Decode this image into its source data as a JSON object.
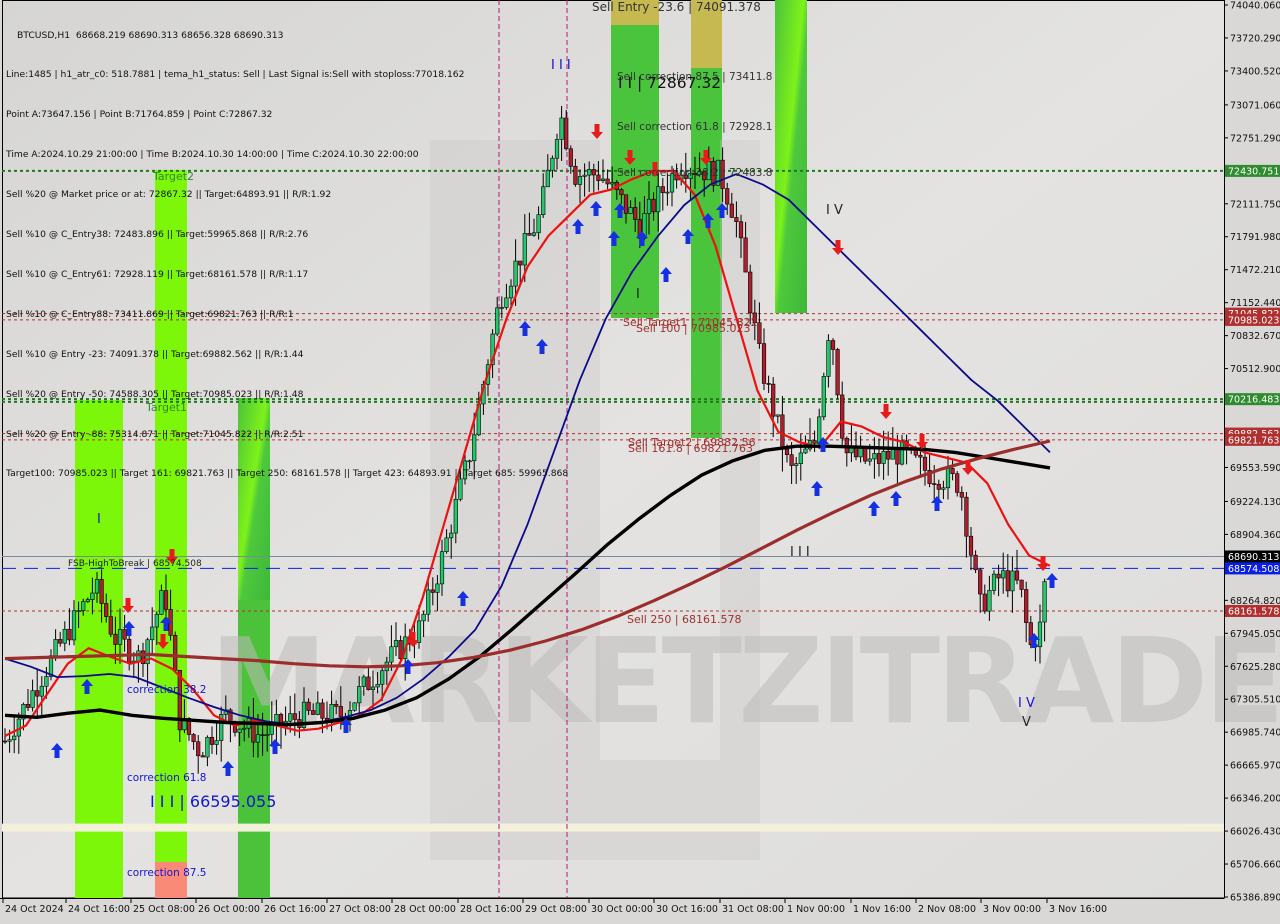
{
  "chart_data": {
    "type": "candlestick",
    "symbol": "BTCUSD",
    "timeframe": "H1",
    "ohlc_header": "BTCUSD,H1  68668.219 68690.313 68656.328 68690.313",
    "info_lines": [
      "Line:1485 | h1_atr_c0: 518.7881 | tema_h1_status: Sell | Last Signal is:Sell with stoploss:77018.162",
      "Point A:73647.156 | Point B:71764.859 | Point C:72867.32",
      "Time A:2024.10.29 21:00:00 | Time B:2024.10.30 14:00:00 | Time C:2024.10.30 22:00:00",
      "Sell %20 @ Market price or at: 72867.32 || Target:64893.91 || R/R:1.92",
      "Sell %10 @ C_Entry38: 72483.896 || Target:59965.868 || R/R:2.76",
      "Sell %10 @ C_Entry61: 72928.119 || Target:68161.578 || R/R:1.17",
      "Sell %10 @ C_Entry88: 73411.869 || Target:69821.763 || R/R:1",
      "Sell %10 @ Entry -23: 74091.378 || Target:69882.562 || R/R:1.44",
      "Sell %20 @ Entry -50: 74588.305 || Target:70985.023 || R/R:1.48",
      "Sell %20 @ Entry -88: 75314.871 || Target:71045.822 || R/R:2.51",
      "Target100: 70985.023 || Target 161: 69821.763 || Target 250: 68161.578 || Target 423: 64893.91 || Target 685: 59965.868"
    ],
    "ylim": [
      65386.89,
      74040.06
    ],
    "y_ticks": [
      "74040.060",
      "73720.290",
      "73400.520",
      "73071.060",
      "72751.290",
      "72430.751",
      "72111.750",
      "71791.980",
      "71472.210",
      "71152.440",
      "70832.670",
      "70512.900",
      "70216.483",
      "69553.590",
      "69224.130",
      "68904.360",
      "68690.313",
      "68574.508",
      "68264.820",
      "67945.050",
      "67625.280",
      "67305.510",
      "66985.740",
      "66665.970",
      "66346.200",
      "66026.430",
      "65706.660",
      "65386.890"
    ],
    "x_ticks": [
      "24 Oct 2024",
      "24 Oct 16:00",
      "25 Oct 08:00",
      "26 Oct 00:00",
      "26 Oct 16:00",
      "27 Oct 08:00",
      "28 Oct 00:00",
      "28 Oct 16:00",
      "29 Oct 08:00",
      "30 Oct 00:00",
      "30 Oct 16:00",
      "31 Oct 08:00",
      "1 Nov 00:00",
      "1 Nov 16:00",
      "2 Nov 08:00",
      "3 Nov 00:00",
      "3 Nov 16:00"
    ],
    "price_labels": [
      {
        "value": 72430.751,
        "text": "72430.751",
        "color": "#2e8b2e"
      },
      {
        "value": 71045.822,
        "text": "71045.822",
        "color": "#b03030"
      },
      {
        "value": 70985.023,
        "text": "70985.023",
        "color": "#b03030"
      },
      {
        "value": 70216.483,
        "text": "70216.483",
        "color": "#2e8b2e"
      },
      {
        "value": 69882.562,
        "text": "69882.562",
        "color": "#b03030"
      },
      {
        "value": 69821.763,
        "text": "69821.763",
        "color": "#b03030"
      },
      {
        "value": 68690.313,
        "text": "68690.313",
        "color": "#000000"
      },
      {
        "value": 68574.508,
        "text": "68574.508",
        "color": "#0a1ee6"
      },
      {
        "value": 68161.578,
        "text": "68161.578",
        "color": "#b03030"
      }
    ],
    "hlines": [
      {
        "value": 72430.751,
        "color": "#1f7a1f",
        "style": "dotted"
      },
      {
        "value": 71045.822,
        "color": "#b03030",
        "style": "dotted"
      },
      {
        "value": 70985.023,
        "color": "#b03030",
        "style": "dotted"
      },
      {
        "value": 70216.483,
        "color": "#1f7a1f",
        "style": "dotted"
      },
      {
        "value": 70190,
        "color": "#1f7a1f",
        "style": "dotted"
      },
      {
        "value": 69882.562,
        "color": "#b03030",
        "style": "dotted"
      },
      {
        "value": 69821.763,
        "color": "#b03030",
        "style": "dotted"
      },
      {
        "value": 68690.313,
        "color": "#7a8a9a",
        "style": "solid"
      },
      {
        "value": 68574.508,
        "color": "#0a1ee6",
        "style": "dashed"
      },
      {
        "value": 68161.578,
        "color": "#b03030",
        "style": "dotted"
      },
      {
        "value": 66060,
        "color": "#f3f1dc",
        "style": "band"
      }
    ],
    "annotations": [
      {
        "text": "Sell Entry -23.6 | 74091.378",
        "color": "#333333"
      },
      {
        "text": "Sell correction 87.5 | 73411.8",
        "color": "#333333"
      },
      {
        "text": "I I | 72867.32",
        "color": "#111111"
      },
      {
        "text": "Sell correction 61.8 | 72928.1",
        "color": "#333333"
      },
      {
        "text": "Sell correction 38.2 | 72483.8",
        "color": "#333333"
      },
      {
        "text": "Sell Target1 | 71045.822",
        "color": "#a03030"
      },
      {
        "text": "Sell 100 | 70985.023",
        "color": "#a03030"
      },
      {
        "text": "Sell Target2 | 69882.56",
        "color": "#a03030"
      },
      {
        "text": "Sell 161.8 | 69821.763",
        "color": "#a03030"
      },
      {
        "text": "Sell 250 | 68161.578",
        "color": "#a03030"
      },
      {
        "text": "FSB-HighToBreak | 68574.508",
        "color": "#222222"
      },
      {
        "text": "Target2",
        "color": "#2e8b2e"
      },
      {
        "text": "Target1",
        "color": "#2e8b2e"
      },
      {
        "text": "correction 38.2",
        "color": "#1515d0"
      },
      {
        "text": "correction 61.8",
        "color": "#1515d0"
      },
      {
        "text": "correction 87.5",
        "color": "#1515d0"
      },
      {
        "text": "I I I | 66595.055",
        "color": "#1515d0"
      },
      {
        "text": "I I I",
        "color": "#1515d0"
      },
      {
        "text": "I V",
        "color": "#222222"
      },
      {
        "text": "I I I",
        "color": "#222222"
      },
      {
        "text": "I V",
        "color": "#1515d0"
      },
      {
        "text": "V",
        "color": "#222222"
      },
      {
        "text": "I",
        "color": "#1515d0"
      },
      {
        "text": "I",
        "color": "#222222"
      }
    ],
    "series": [
      {
        "name": "MA fast (red)",
        "color": "#ee1111",
        "values": [
          66950,
          67050,
          67350,
          67650,
          67800,
          67720,
          67650,
          67700,
          67600,
          67400,
          67150,
          67050,
          67100,
          67050,
          67000,
          67020,
          67080,
          67150,
          67300,
          67700,
          68300,
          69000,
          69700,
          70400,
          71000,
          71500,
          71800,
          72000,
          72200,
          72250,
          72350,
          72430,
          72430,
          72200,
          71700,
          71000,
          70300,
          69900,
          69800,
          69750,
          70000,
          69950,
          69850,
          69800,
          69700,
          69650,
          69600,
          69400,
          69000,
          68700,
          68600
        ]
      },
      {
        "name": "MA mid (navy)",
        "color": "#0b0b8a",
        "values": [
          67700,
          67620,
          67520,
          67530,
          67550,
          67520,
          67420,
          67320,
          67230,
          67150,
          67090,
          67060,
          67080,
          67130,
          67200,
          67320,
          67500,
          67720,
          67980,
          68400,
          69000,
          69700,
          70400,
          71000,
          71450,
          71800,
          72100,
          72300,
          72400,
          72300,
          72150,
          71900,
          71650,
          71400,
          71150,
          70900,
          70650,
          70400,
          70200,
          69950,
          69700
        ]
      },
      {
        "name": "MA slow (black)",
        "color": "#000000",
        "values": [
          67150,
          67130,
          67170,
          67200,
          67150,
          67120,
          67100,
          67080,
          67070,
          67060,
          67080,
          67120,
          67200,
          67320,
          67500,
          67720,
          67980,
          68250,
          68520,
          68800,
          69050,
          69280,
          69480,
          69620,
          69720,
          69760,
          69760,
          69750,
          69740,
          69730,
          69700,
          69650,
          69600,
          69550
        ]
      },
      {
        "name": "MA long (brown)",
        "color": "#9b2d2d",
        "values": [
          67700,
          67710,
          67720,
          67730,
          67740,
          67720,
          67700,
          67680,
          67650,
          67630,
          67620,
          67630,
          67660,
          67710,
          67780,
          67870,
          67980,
          68110,
          68260,
          68420,
          68590,
          68770,
          68950,
          69120,
          69280,
          69420,
          69540,
          69640,
          69730,
          69810
        ]
      }
    ]
  }
}
